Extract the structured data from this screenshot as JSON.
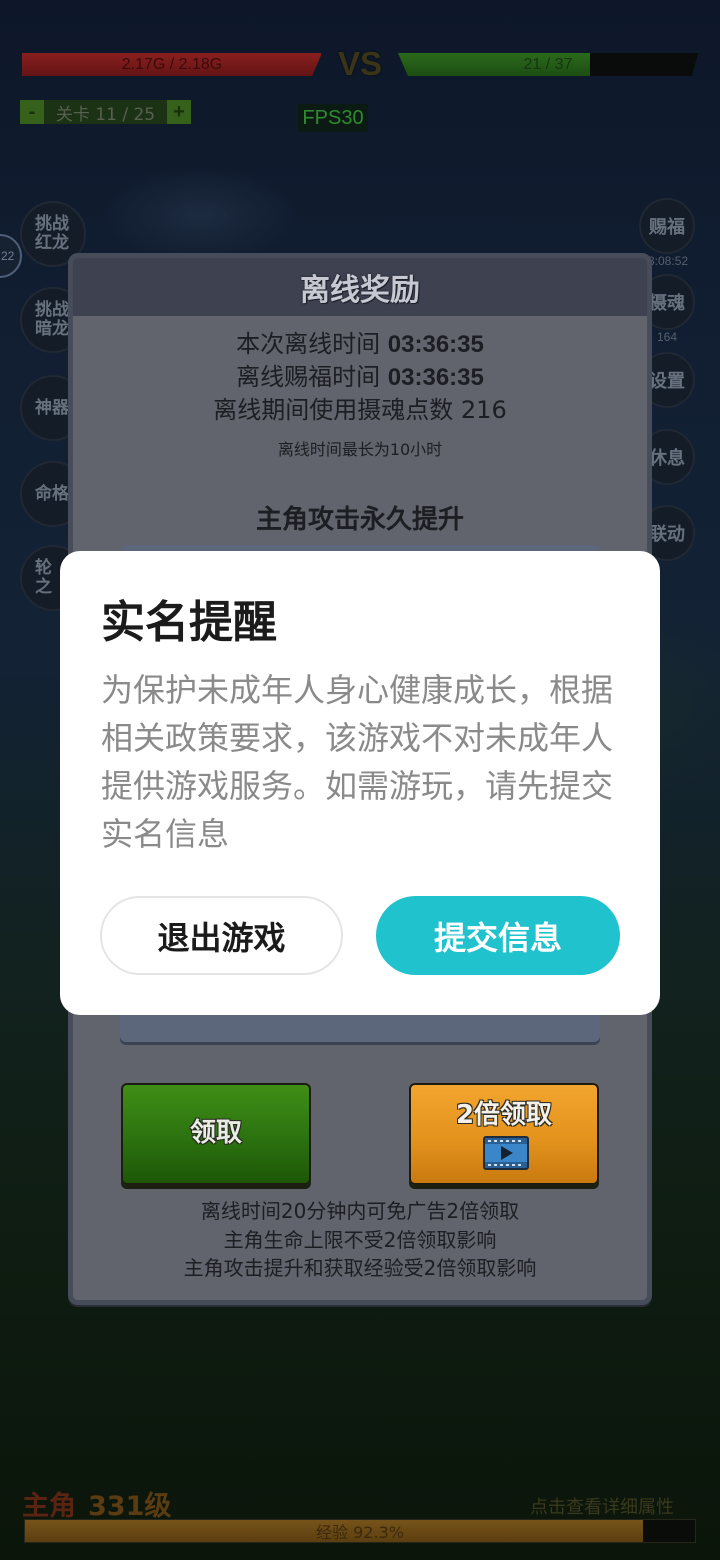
{
  "hud": {
    "hp_left": {
      "text": "2.17G / 2.18G",
      "fill": 0.995
    },
    "vs": "VS",
    "hp_right": {
      "text": "21 / 37",
      "fill": 0.64
    },
    "level": {
      "minus": "-",
      "label": "关卡 11 / 25",
      "plus": "+"
    },
    "fps": "FPS30"
  },
  "left_badge": "22",
  "left_buttons": [
    {
      "lines": [
        "挑战",
        "红龙"
      ]
    },
    {
      "lines": [
        "挑战",
        "暗龙"
      ]
    },
    {
      "lines": [
        "神器"
      ]
    },
    {
      "lines": [
        "命格"
      ]
    },
    {
      "lines": [
        "轮",
        "之"
      ]
    }
  ],
  "right_buttons": [
    {
      "label": "赐福",
      "sub": "3:08:52"
    },
    {
      "label": "摄魂",
      "sub": "164"
    },
    {
      "label": "设置"
    },
    {
      "label": "休息"
    },
    {
      "label": "联动"
    }
  ],
  "offline_panel": {
    "title": "离线奖励",
    "offline_time": {
      "label": "本次离线时间",
      "value": "03:36:35"
    },
    "blessing_time": {
      "label": "离线赐福时间",
      "value": "03:36:35"
    },
    "soul_points": {
      "label": "离线期间使用摄魂点数",
      "value": "216"
    },
    "max_note": "离线时间最长为10小时",
    "attack_title": "主角攻击永久提升",
    "claim_label": "领取",
    "double_claim_label": "2倍领取",
    "double_claim_icon": "video-ad-icon",
    "notes": [
      "离线时间20分钟内可免广告2倍领取",
      "主角生命上限不受2倍领取影响",
      "主角攻击提升和获取经验受2倍领取影响"
    ]
  },
  "player": {
    "name": "主角",
    "level": "331级",
    "details_link": "点击查看详细属性",
    "exp_label": "经验 92.3%",
    "exp_fraction": 0.923
  },
  "dialog": {
    "title": "实名提醒",
    "body_lines": [
      "为保护未成年人身心健康成长，根据",
      "相关政策要求，该游戏不对未成年人",
      "提供游戏服务。如需游玩，请先提交",
      "实名信息"
    ],
    "exit_label": "退出游戏",
    "submit_label": "提交信息"
  },
  "colors": {
    "submit_button": "#1fc2cd",
    "dialog_background": "#ffffff",
    "dialog_body_text": "#8a8a8a",
    "claim_button": "#2c7210",
    "double_claim_button": "#e4931d",
    "hp_left": "#8a1f1f",
    "hp_right": "#2a6a1c"
  }
}
